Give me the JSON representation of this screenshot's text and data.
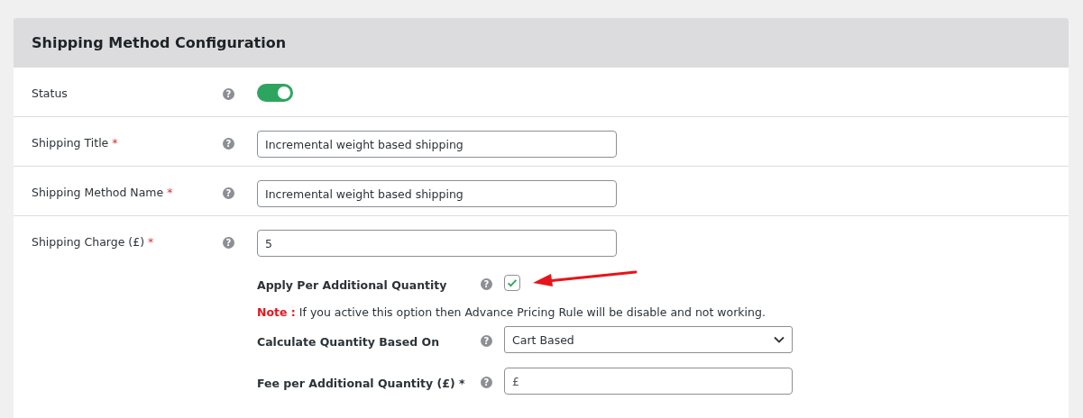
{
  "panel": {
    "title": "Shipping Method Configuration"
  },
  "fields": [
    {
      "kind": "toggle",
      "label": "Status",
      "help": "?",
      "on": true
    },
    {
      "kind": "text",
      "label": "Shipping Title",
      "required_mark": "*",
      "help": "?",
      "value": "Incremental weight based shipping"
    },
    {
      "kind": "text",
      "label": "Shipping Method Name",
      "required_mark": "*",
      "help": "?",
      "value": "Incremental weight based shipping"
    },
    {
      "kind": "charge",
      "label": "Shipping Charge (£)",
      "required_mark": "*",
      "help": "?",
      "value": "5",
      "sub_fields": [
        {
          "kind": "checkbox",
          "label": "Apply Per Additional Quantity",
          "help": "?",
          "checked": true
        },
        {
          "kind": "note",
          "note_label": "Note :",
          "text": "If you active this option then Advance Pricing Rule will be disable and not working."
        },
        {
          "kind": "select",
          "label": "Calculate Quantity Based On",
          "help": "?",
          "value": "Cart Based"
        },
        {
          "kind": "text",
          "label": "Fee per Additional Quantity (£) *",
          "help": "?",
          "placeholder": "£"
        }
      ]
    }
  ]
}
